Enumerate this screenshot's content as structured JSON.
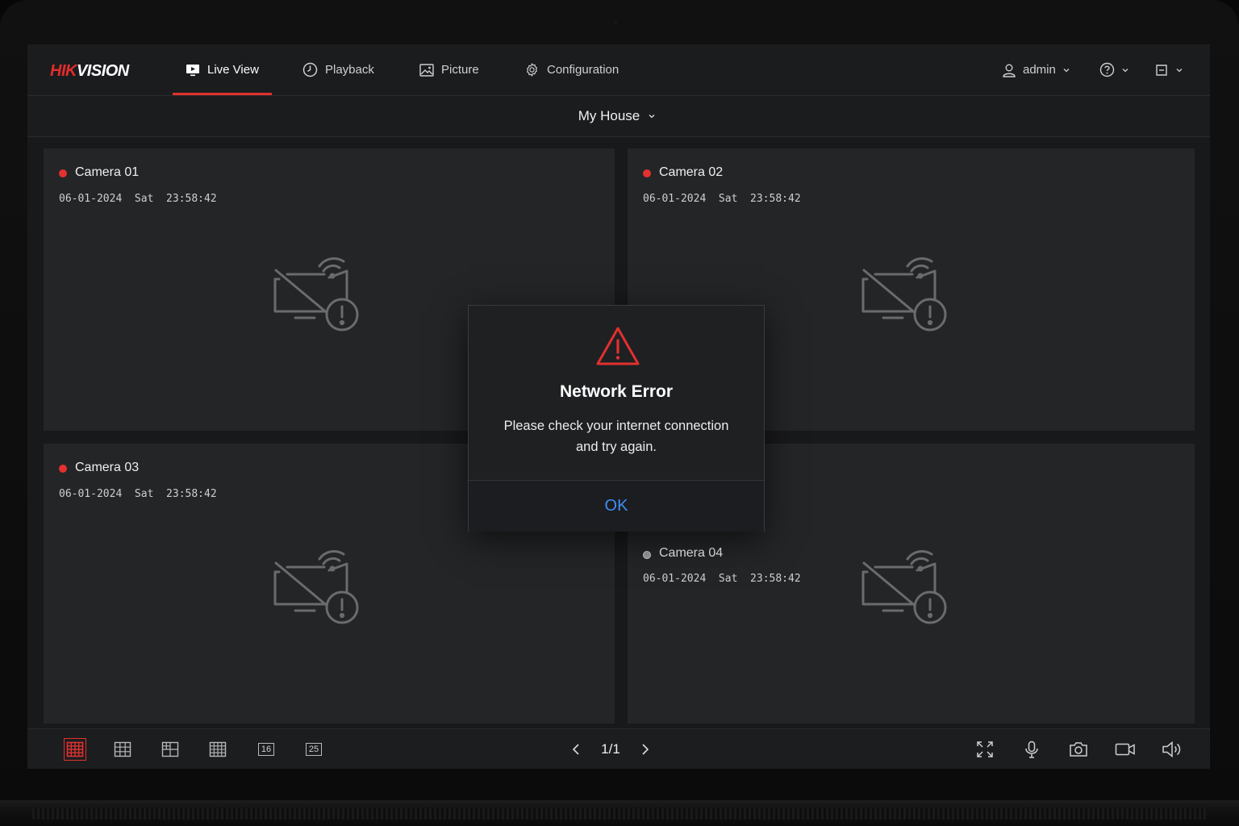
{
  "brand": {
    "logo_prefix": "HIK",
    "logo_suffix": "VISION"
  },
  "nav": {
    "items": [
      {
        "label": "Live View",
        "icon": "live-view-icon",
        "active": true
      },
      {
        "label": "Playback",
        "icon": "playback-icon",
        "active": false
      },
      {
        "label": "Picture",
        "icon": "picture-icon",
        "active": false
      },
      {
        "label": "Configuration",
        "icon": "gear-icon",
        "active": false
      }
    ],
    "user": "admin"
  },
  "site": {
    "selected": "My House"
  },
  "cameras": [
    {
      "name": "Camera 01",
      "timestamp": "06-01-2024  Sat  23:58:42",
      "status": "recording"
    },
    {
      "name": "Camera 02",
      "timestamp": "06-01-2024  Sat  23:58:42",
      "status": "recording"
    },
    {
      "name": "Camera 03",
      "timestamp": "06-01-2024  Sat  23:58:42",
      "status": "recording"
    },
    {
      "name": "Camera 04",
      "timestamp": "06-01-2024  Sat  23:58:42",
      "status": "idle"
    }
  ],
  "toolbar": {
    "layouts": [
      "2x2",
      "3x3-a",
      "3x3-b",
      "4x4",
      "16",
      "25"
    ],
    "layout_16_label": "16",
    "layout_25_label": "25",
    "page": "1/1"
  },
  "dialog": {
    "title": "Network Error",
    "message": "Please check your internet connection and try again.",
    "ok_label": "OK"
  },
  "colors": {
    "accent_red": "#e0312f",
    "link_blue": "#3f8ff5",
    "background": "#1a1b1d"
  }
}
